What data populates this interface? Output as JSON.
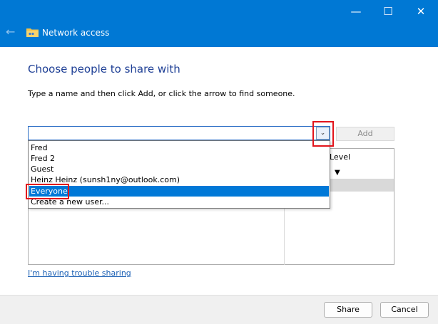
{
  "window": {
    "title": "Network access",
    "caption_buttons": {
      "minimize": "—",
      "maximize": "☐",
      "close": "✕"
    }
  },
  "main": {
    "heading": "Choose people to share with",
    "instructions": "Type a name and then click Add, or click the arrow to find someone.",
    "name_input_value": "",
    "add_label": "Add",
    "columns": {
      "permission_level": "Level"
    },
    "dropdown_items": [
      {
        "label": "Fred",
        "selected": false
      },
      {
        "label": "Fred 2",
        "selected": false
      },
      {
        "label": "Guest",
        "selected": false
      },
      {
        "label": "Heinz Heinz (sunsh1ny@outlook.com)",
        "selected": false
      },
      {
        "label": "Everyone",
        "selected": true
      },
      {
        "label": "Create a new user...",
        "selected": false
      }
    ],
    "trouble_link": "I'm having trouble sharing"
  },
  "footer": {
    "share_label": "Share",
    "cancel_label": "Cancel"
  },
  "colors": {
    "titlebar": "#0078d4",
    "heading": "#1e3f95",
    "selection": "#0078d7",
    "highlight_box": "#e2141b"
  },
  "icons": {
    "back": "back-arrow-icon",
    "folder": "shared-folder-icon",
    "dropdown": "chevron-down-icon",
    "permission": "caret-down-icon"
  }
}
